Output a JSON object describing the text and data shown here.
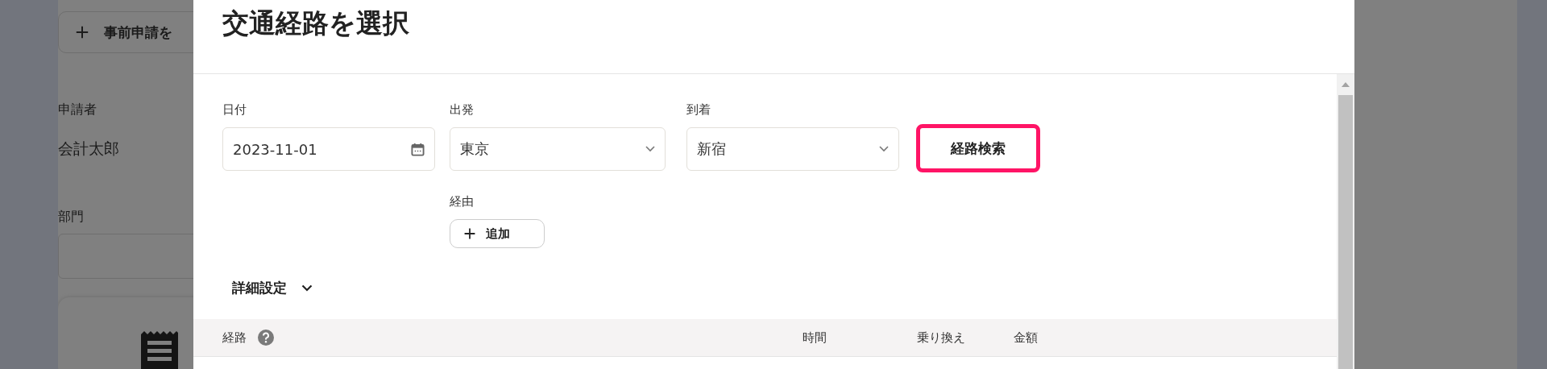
{
  "background_page": {
    "new_request_button": "事前申請を",
    "applicant": {
      "label": "申請者",
      "value": "会計太郎"
    },
    "department": {
      "label": "部門"
    }
  },
  "dialog": {
    "title": "交通経路を選択",
    "date": {
      "label": "日付",
      "value": "2023-11-01"
    },
    "departure": {
      "label": "出発",
      "value": "東京"
    },
    "arrival": {
      "label": "到着",
      "value": "新宿"
    },
    "search_button": {
      "label": "経路検索",
      "highlighted": true
    },
    "via": {
      "label": "経由",
      "add_button": "追加"
    },
    "advanced": {
      "label": "詳細設定",
      "expanded": false
    },
    "table": {
      "columns": [
        "経路",
        "時間",
        "乗り換え",
        "金額"
      ]
    }
  }
}
